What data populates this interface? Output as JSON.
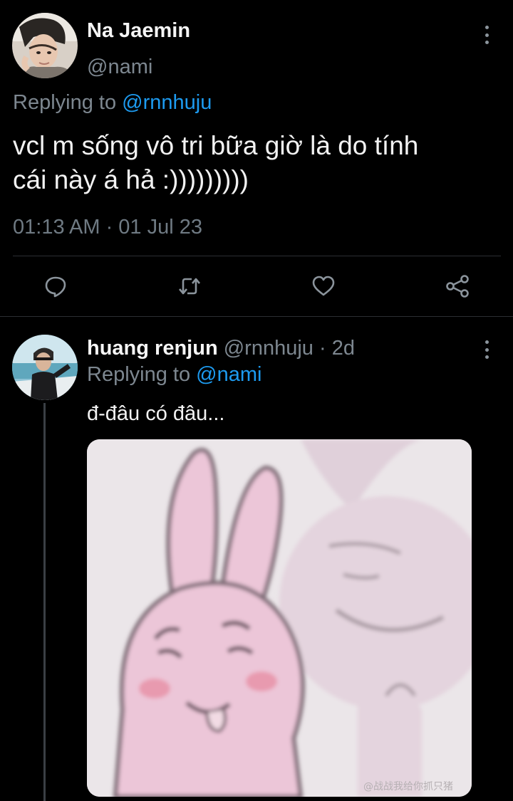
{
  "main_tweet": {
    "display_name": "Na Jaemin",
    "handle": "@nami",
    "replying_prefix": "Replying to",
    "replying_handle": "@rnnhuju",
    "text_line_1": "vcl m sống vô tri bữa giờ là do tính",
    "text_line_2": "cái này á hả  :)))))))))",
    "timestamp": "01:13 AM · 01 Jul 23",
    "actions": [
      "reply-icon",
      "retweet-icon",
      "like-icon",
      "share-icon"
    ]
  },
  "reply_tweet": {
    "display_name": "huang renjun",
    "handle": "@rnnhuju",
    "separator": "·",
    "time_ago": "2d",
    "replying_prefix": "Replying to",
    "replying_handle": "@nami",
    "text": "đ-đâu có đâu...",
    "image_watermark": "@战战我给你抓只猪"
  },
  "colors": {
    "background": "#000000",
    "text_primary": "#f2f2f2",
    "text_secondary": "#7d8790",
    "link": "#1d9bf0",
    "divider": "#2b2f33",
    "icon": "#8b949c"
  }
}
